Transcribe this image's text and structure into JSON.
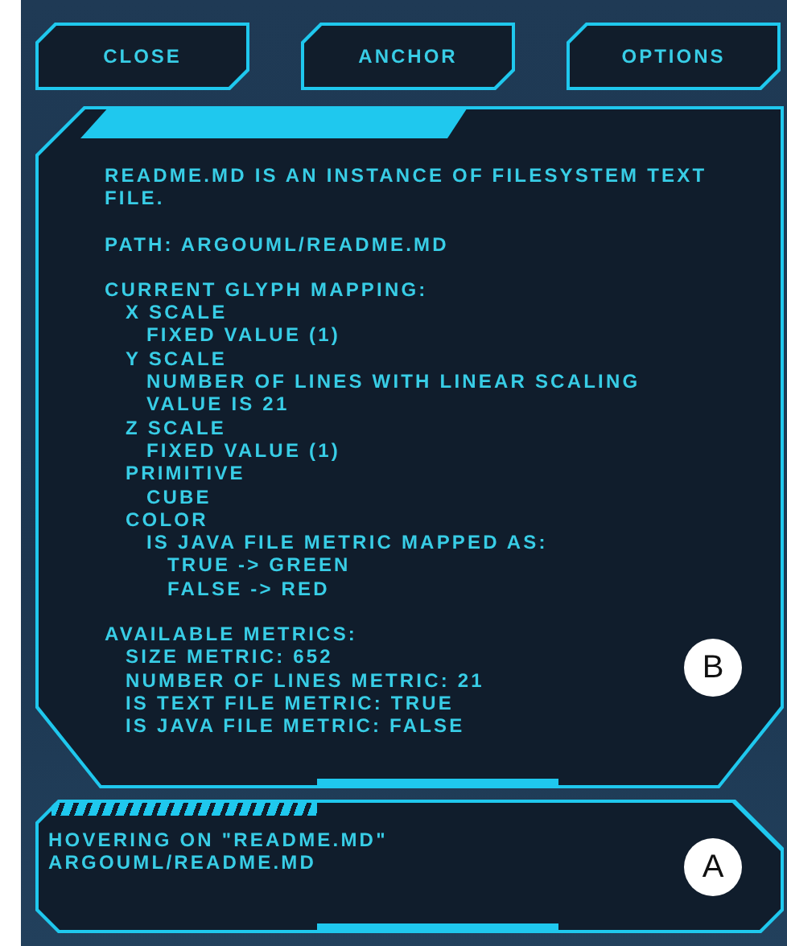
{
  "buttons": [
    {
      "label": "CLOSE"
    },
    {
      "label": "ANCHOR"
    },
    {
      "label": "OPTIONS"
    }
  ],
  "info_panel": {
    "description": "README.MD IS AN INSTANCE OF FILESYSTEM TEXT FILE.",
    "path": "PATH: ARGOUML/README.MD",
    "sections": [
      {
        "text": "CURRENT GLYPH MAPPING:",
        "children": [
          {
            "text": "X SCALE",
            "children": [
              {
                "text": "FIXED VALUE (1)"
              }
            ]
          },
          {
            "text": "Y SCALE",
            "children": [
              {
                "text": "NUMBER OF LINES WITH LINEAR SCALING"
              },
              {
                "text": "VALUE IS 21"
              }
            ]
          },
          {
            "text": "Z SCALE",
            "children": [
              {
                "text": "FIXED VALUE (1)"
              }
            ]
          },
          {
            "text": "PRIMITIVE",
            "children": [
              {
                "text": "CUBE"
              }
            ]
          },
          {
            "text": "COLOR",
            "children": [
              {
                "text": "IS JAVA FILE METRIC MAPPED AS:",
                "children": [
                  {
                    "text": "TRUE -> GREEN"
                  },
                  {
                    "text": "FALSE -> RED"
                  }
                ]
              }
            ]
          }
        ]
      },
      {
        "text": "AVAILABLE METRICS:",
        "children": [
          {
            "text": "SIZE METRIC: 652"
          },
          {
            "text": "NUMBER OF LINES METRIC: 21"
          },
          {
            "text": "IS TEXT FILE METRIC: TRUE"
          },
          {
            "text": "IS JAVA FILE METRIC: FALSE"
          }
        ]
      }
    ],
    "callout": "B"
  },
  "status_panel": {
    "lines": [
      "HOVERING ON \"README.MD\"",
      "ARGOUML/README.MD"
    ],
    "callout": "A"
  }
}
